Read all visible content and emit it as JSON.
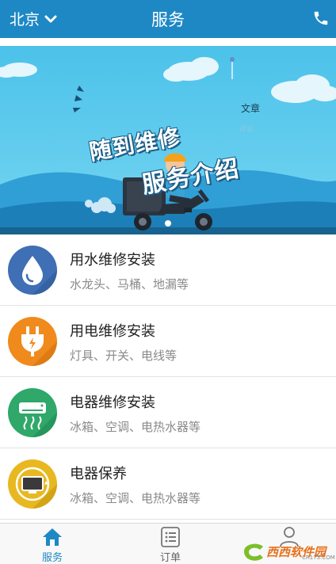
{
  "header": {
    "city": "北京",
    "title": "服务"
  },
  "banner": {
    "headline_1": "随到维修",
    "headline_2": "服务介绍",
    "tag_article": "文章",
    "tag_comment": "评论",
    "slide_count": 1,
    "active_slide": 1
  },
  "services": [
    {
      "name": "用水维修安装",
      "desc": "水龙头、马桶、地漏等",
      "color": "#3f6fb5",
      "icon": "water-drop-icon"
    },
    {
      "name": "用电维修安装",
      "desc": "灯具、开关、电线等",
      "color": "#f08a1c",
      "icon": "plug-icon"
    },
    {
      "name": "电器维修安装",
      "desc": "冰箱、空调、电热水器等",
      "color": "#2fa86a",
      "icon": "air-conditioner-icon"
    },
    {
      "name": "电器保养",
      "desc": "冰箱、空调、电热水器等",
      "color": "#e8b820",
      "icon": "tv-icon"
    }
  ],
  "bottom_nav": {
    "home": "服务",
    "order": "订单",
    "mine": ""
  },
  "watermark": {
    "text": "西西软件园",
    "sub": "CR173.COM"
  },
  "colors": {
    "primary": "#1e88c4"
  }
}
